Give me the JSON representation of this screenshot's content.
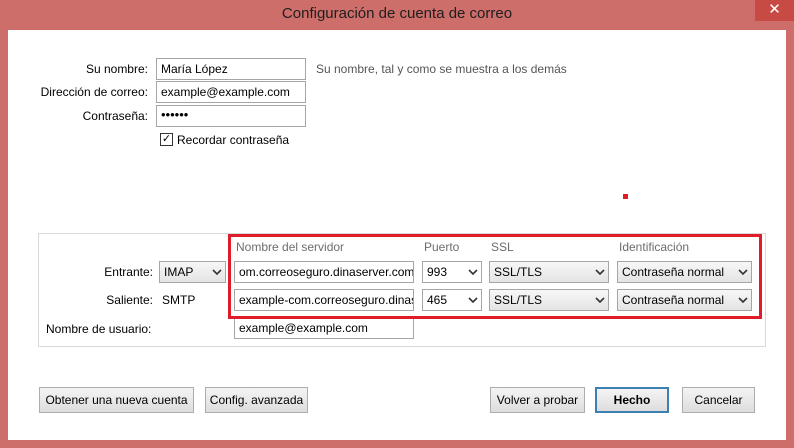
{
  "window": {
    "title": "Configuración de cuenta de correo",
    "close_glyph": "✕"
  },
  "form": {
    "name_label": "Su nombre:",
    "name_value": "María López",
    "name_hint": "Su nombre, tal y como se muestra a los demás",
    "email_label": "Dirección de correo:",
    "email_value": "example@example.com",
    "password_label": "Contraseña:",
    "password_value": "••••••",
    "remember_label": "Recordar contraseña",
    "remember_checked": true,
    "check_glyph": "✓"
  },
  "server": {
    "headers": {
      "server_name": "Nombre del servidor",
      "port": "Puerto",
      "ssl": "SSL",
      "auth": "Identificación"
    },
    "incoming": {
      "label": "Entrante:",
      "protocol": "IMAP",
      "hostname": "om.correoseguro.dinaserver.com",
      "port": "993",
      "ssl": "SSL/TLS",
      "auth": "Contraseña normal"
    },
    "outgoing": {
      "label": "Saliente:",
      "protocol": "SMTP",
      "hostname": "example-com.correoseguro.dinaserver.com",
      "port": "465",
      "ssl": "SSL/TLS",
      "auth": "Contraseña normal"
    },
    "username_label": "Nombre de usuario:",
    "username_value": "example@example.com"
  },
  "buttons": {
    "new_account": "Obtener una nueva cuenta",
    "advanced": "Config. avanzada",
    "retest": "Volver a probar",
    "done": "Hecho",
    "cancel": "Cancelar"
  },
  "colors": {
    "highlight": "#e01b2a",
    "titlebar": "#cd6e6a"
  }
}
